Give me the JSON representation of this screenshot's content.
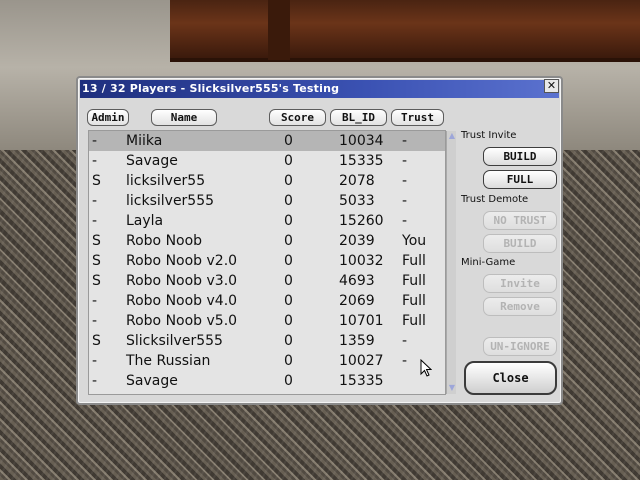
{
  "window": {
    "title": "13 / 32 Players - Slicksilver555's Testing",
    "close_glyph": "✕"
  },
  "columns": {
    "admin": "Admin",
    "name": "Name",
    "score": "Score",
    "blid": "BL_ID",
    "trust": "Trust"
  },
  "players": [
    {
      "admin": "-",
      "name": "Miika",
      "score": "0",
      "blid": "10034",
      "trust": "-"
    },
    {
      "admin": "-",
      "name": "Savage",
      "score": "0",
      "blid": "15335",
      "trust": "-"
    },
    {
      "admin": "S",
      "name": "licksilver55",
      "score": "0",
      "blid": "2078",
      "trust": "-"
    },
    {
      "admin": "-",
      "name": "licksilver555",
      "score": "0",
      "blid": "5033",
      "trust": "-"
    },
    {
      "admin": "-",
      "name": "Layla",
      "score": "0",
      "blid": "15260",
      "trust": "-"
    },
    {
      "admin": "S",
      "name": "Robo Noob",
      "score": "0",
      "blid": "2039",
      "trust": "You"
    },
    {
      "admin": "S",
      "name": "Robo Noob v2.0",
      "score": "0",
      "blid": "10032",
      "trust": "Full"
    },
    {
      "admin": "S",
      "name": "Robo Noob v3.0",
      "score": "0",
      "blid": "4693",
      "trust": "Full"
    },
    {
      "admin": "-",
      "name": "Robo Noob v4.0",
      "score": "0",
      "blid": "2069",
      "trust": "Full"
    },
    {
      "admin": "-",
      "name": "Robo Noob v5.0",
      "score": "0",
      "blid": "10701",
      "trust": "Full"
    },
    {
      "admin": "S",
      "name": "Slicksilver555",
      "score": "0",
      "blid": "1359",
      "trust": "-"
    },
    {
      "admin": "-",
      "name": "The Russian",
      "score": "0",
      "blid": "10027",
      "trust": "-"
    },
    {
      "admin": "-",
      "name": "Savage",
      "score": "0",
      "blid": "15335",
      "trust": ""
    }
  ],
  "selected_row": 0,
  "side": {
    "trust_invite_label": "Trust Invite",
    "build_label": "BUILD",
    "full_label": "FULL",
    "trust_demote_label": "Trust Demote",
    "no_trust_label": "NO TRUST",
    "demote_build_label": "BUILD",
    "minigame_label": "Mini-Game",
    "invite_label": "Invite",
    "remove_label": "Remove",
    "unignore_label": "UN-IGNORE",
    "close_label": "Close"
  },
  "scrollbar": {
    "up_arrow": "▲",
    "down_arrow": "▼"
  },
  "colors": {
    "title_bar": "#2a3c96",
    "selected_row": "#b5b5b5"
  }
}
